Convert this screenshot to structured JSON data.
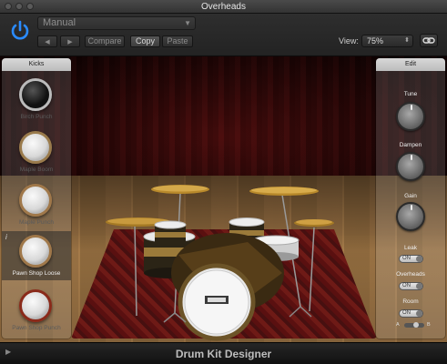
{
  "window": {
    "title": "Overheads"
  },
  "header": {
    "preset": "Manual",
    "compare_label": "Compare",
    "copy_label": "Copy",
    "paste_label": "Paste",
    "view_label": "View:",
    "view_value": "75%"
  },
  "kicks_panel": {
    "title": "Kicks",
    "items": [
      {
        "label": "Birch Punch",
        "style": "black"
      },
      {
        "label": "Maple Boom",
        "style": "light"
      },
      {
        "label": "Maple Punch",
        "style": "light"
      },
      {
        "label": "Pawn Shop Loose",
        "style": "brown",
        "selected": true
      },
      {
        "label": "Pawn Shop Punch",
        "style": "red"
      }
    ]
  },
  "edit_panel": {
    "title": "Edit",
    "tune_label": "Tune",
    "dampen_label": "Dampen",
    "gain_label": "Gain",
    "leak_label": "Leak",
    "leak_state": "ON",
    "overheads_label": "Overheads",
    "overheads_state": "ON",
    "room_label": "Room",
    "room_state": "ON",
    "ab_left": "A",
    "ab_right": "B"
  },
  "footer": {
    "title": "Drum Kit Designer"
  },
  "colors": {
    "power_blue": "#2a8bff",
    "panel": "#dcdcdc"
  }
}
